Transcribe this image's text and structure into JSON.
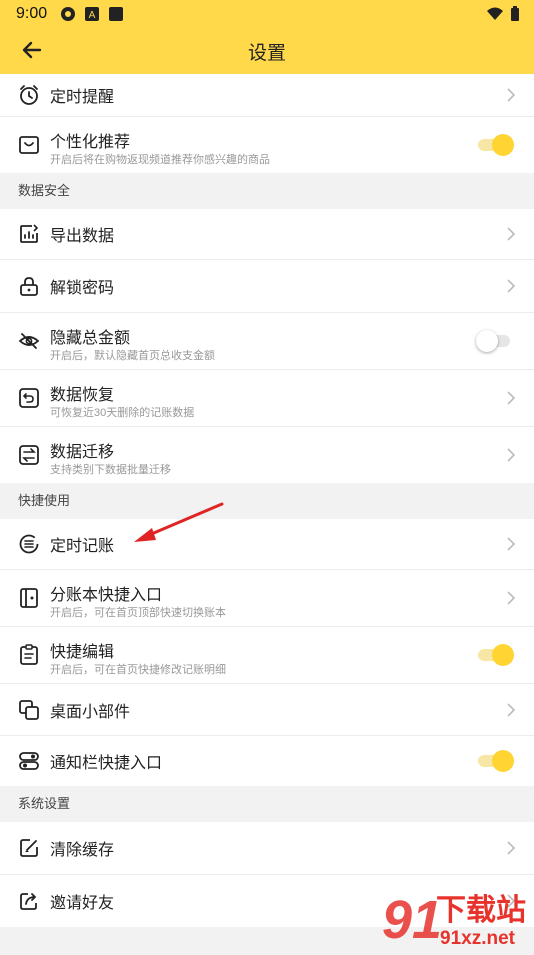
{
  "status_bar": {
    "time": "9:00"
  },
  "app_bar": {
    "title": "设置"
  },
  "groups": [
    {
      "rows": [
        {
          "label": "定时提醒",
          "sub": "",
          "control": "chevron"
        },
        {
          "label": "个性化推荐",
          "sub": "开启后将在购物返现频道推荐你感兴趣的商品",
          "control": "toggle",
          "value": true
        }
      ]
    },
    {
      "section": "数据安全",
      "rows": [
        {
          "label": "导出数据",
          "control": "chevron"
        },
        {
          "label": "解锁密码",
          "control": "chevron"
        },
        {
          "label": "隐藏总金额",
          "sub": "开启后，默认隐藏首页总收支金额",
          "control": "toggle",
          "value": false
        },
        {
          "label": "数据恢复",
          "sub": "可恢复近30天删除的记账数据",
          "control": "chevron"
        },
        {
          "label": "数据迁移",
          "sub": "支持类别下数据批量迁移",
          "control": "chevron"
        }
      ]
    },
    {
      "section": "快捷使用",
      "rows": [
        {
          "label": "定时记账",
          "control": "chevron"
        },
        {
          "label": "分账本快捷入口",
          "sub": "开启后，可在首页顶部快速切换账本",
          "control": "chevron"
        },
        {
          "label": "快捷编辑",
          "sub": "开启后，可在首页快捷修改记账明细",
          "control": "toggle",
          "value": true
        },
        {
          "label": "桌面小部件",
          "control": "chevron"
        },
        {
          "label": "通知栏快捷入口",
          "control": "toggle",
          "value": true
        }
      ]
    },
    {
      "section": "系统设置",
      "rows": [
        {
          "label": "清除缓存",
          "control": "chevron"
        },
        {
          "label": "邀请好友",
          "control": "chevron"
        }
      ]
    }
  ],
  "watermark": {
    "text": "下载站",
    "url_text": "91xz.net",
    "mark": "91"
  },
  "icons": [
    "alarm-clock-icon",
    "recommend-icon",
    "export-icon",
    "lock-icon",
    "eye-hidden-icon",
    "restore-icon",
    "migrate-icon",
    "schedule-icon",
    "ledger-icon",
    "edit-clipboard-icon",
    "widget-icon",
    "notification-toggle-icon",
    "clear-cache-icon",
    "share-icon"
  ],
  "colors": {
    "accent": "#ffd94a",
    "toggle_on": "#ffd433",
    "annotation_arrow": "#e02424",
    "watermark_red": "#e8332d"
  }
}
